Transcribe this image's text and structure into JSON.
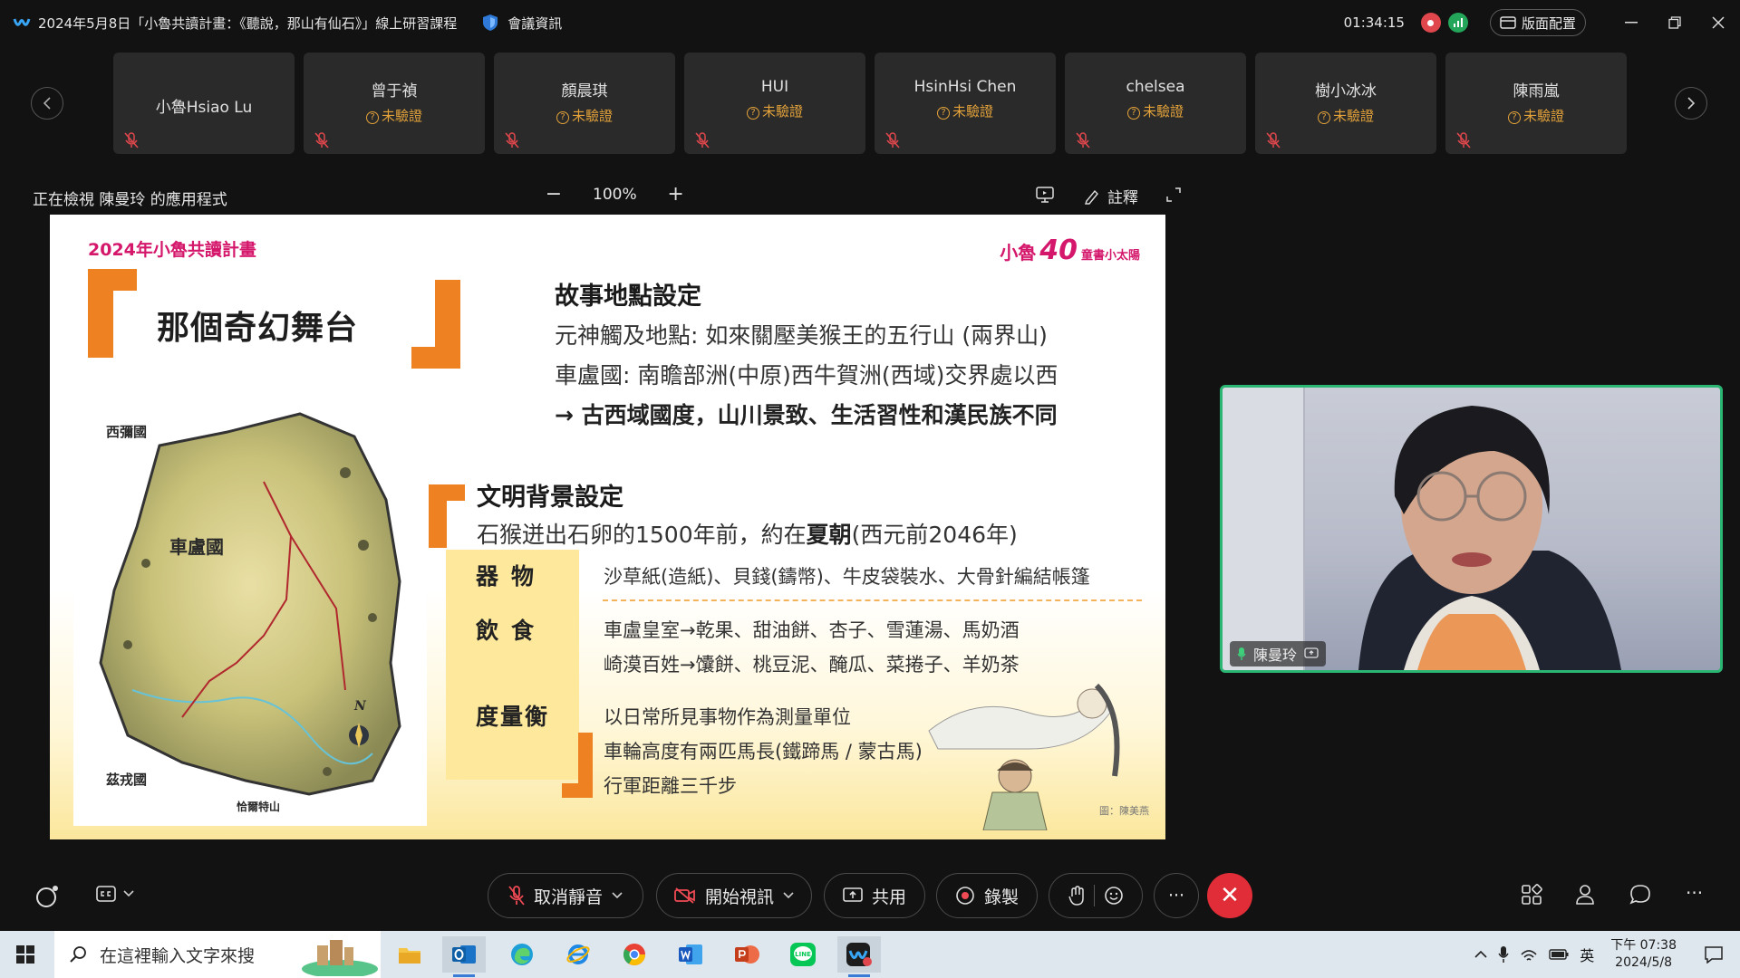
{
  "window": {
    "title": "2024年5月8日「小魯共讀計畫：《聽說，那山有仙石》」線上研習課程",
    "meeting_info": "會議資訊",
    "timer": "01:34:15",
    "layout_button": "版面配置"
  },
  "participants": [
    {
      "name": "小魯Hsiao Lu",
      "badge": ""
    },
    {
      "name": "曾于禎",
      "badge": "未驗證"
    },
    {
      "name": "顏晨琪",
      "badge": "未驗證"
    },
    {
      "name": "HUI",
      "badge": "未驗證"
    },
    {
      "name": "HsinHsi Chen",
      "badge": "未驗證"
    },
    {
      "name": "chelsea",
      "badge": "未驗證"
    },
    {
      "name": "樹小冰冰",
      "badge": "未驗證"
    },
    {
      "name": "陳雨嵐",
      "badge": "未驗證"
    }
  ],
  "share": {
    "label": "正在檢視 陳曼玲 的應用程式",
    "zoom": "100%",
    "zoom_out": "−",
    "zoom_in": "+",
    "annotate": "註釋"
  },
  "slide": {
    "kicker": "2024年小魯共讀計畫",
    "brand_a": "小魯",
    "brand_40": "40",
    "brand_b": "童書小太陽",
    "title": "那個奇幻舞台",
    "map_labels": {
      "west": "西彌國",
      "cheluo": "車盧國",
      "south": "茲戎國",
      "mountain": "恰爾特山",
      "north": "N"
    },
    "section1": {
      "heading": "故事地點設定",
      "lines": [
        "元神觸及地點: 如來關壓美猴王的五行山 (兩界山)",
        "車盧國: 南瞻部洲(中原)西牛賀洲(西域)交界處以西",
        "→ 古西域國度，山川景致、生活習性和漢民族不同"
      ]
    },
    "section2": {
      "heading": "文明背景設定",
      "intro_a": "石猴迸出石卵的1500年前，約在",
      "intro_bold": "夏朝",
      "intro_b": "(西元前2046年)"
    },
    "categories": [
      {
        "label": "器物",
        "items": [
          "沙草紙(造紙)、貝錢(鑄幣)、牛皮袋裝水、大骨針編結帳篷"
        ]
      },
      {
        "label": "飲食",
        "items": [
          "車盧皇室→乾果、甜油餅、杏子、雪蓮湯、馬奶酒",
          "崎漠百姓→馕餅、桃豆泥、醃瓜、菜捲子、羊奶茶"
        ]
      },
      {
        "label": "度量衡",
        "items": [
          "以日常所見事物作為測量單位",
          "車輪高度有兩匹馬長(鐵蹄馬 / 蒙古馬)",
          "行軍距離三千步"
        ]
      }
    ],
    "credit": "圖：陳美燕"
  },
  "video": {
    "name": "陳曼玲"
  },
  "toolbar": {
    "mute": "取消靜音",
    "video": "開始視訊",
    "share": "共用",
    "record": "錄製",
    "more": "···",
    "end": "✕"
  },
  "taskbar": {
    "search_placeholder": "在這裡輸入文字來搜",
    "ime": "英",
    "time": "下午 07:38",
    "date": "2024/5/8"
  },
  "colors": {
    "accent_green": "#2bb673",
    "end_red": "#e02d37",
    "warning": "#e4a33a",
    "slide_pink": "#d4176b",
    "slide_orange": "#ee8122",
    "slide_yellow": "#fde89b"
  }
}
